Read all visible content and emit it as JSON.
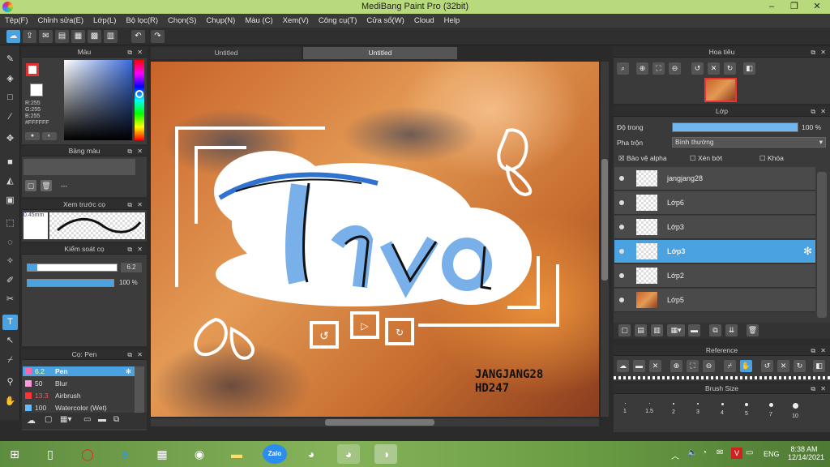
{
  "window": {
    "title": "MediBang Paint Pro (32bit)"
  },
  "menu": [
    "Tệp(F)",
    "Chỉnh sửa(E)",
    "Lớp(L)",
    "Bộ lọc(R)",
    "Chọn(S)",
    "Chụp(N)",
    "Màu (C)",
    "Xem(V)",
    "Công cụ(T)",
    "Cửa sổ(W)",
    "Cloud",
    "Help"
  ],
  "tabs": [
    "Untitled",
    "Untitled"
  ],
  "color_panel": {
    "title": "Màu",
    "r": "R:255",
    "g": "G:255",
    "b": "B:255",
    "hex": "#FFFFFF"
  },
  "palette_panel": {
    "title": "Bảng màu",
    "empty": "---"
  },
  "brush_preview": {
    "title": "Xem trước cọ",
    "size": "0.45mm"
  },
  "brush_control": {
    "title": "Kiểm soát cọ",
    "size_value": "6.2",
    "opacity_value": "100 %"
  },
  "brush_list": {
    "title": "Cọ: Pen",
    "items": [
      {
        "size": "6.2",
        "name": "Pen",
        "color": "#ff66aa"
      },
      {
        "size": "50",
        "name": "Blur",
        "color": "#ff99dd"
      },
      {
        "size": "13.3",
        "name": "Airbrush",
        "color": "#ff3333"
      },
      {
        "size": "100",
        "name": "Watercolor (Wet)",
        "color": "#66bbff"
      }
    ]
  },
  "artwork": {
    "main_text": "Tra",
    "credit_line1": "JANGJANG28",
    "credit_line2": "HD247"
  },
  "navigator": {
    "title": "Hoa tiêu"
  },
  "layer_panel": {
    "title": "Lớp",
    "opacity_label": "Độ trong",
    "opacity_value": "100 %",
    "opacity_fraction": 1.0,
    "blend_label": "Pha trộn",
    "blend_value": "Bình thường",
    "protect_alpha": "Bảo vệ alpha",
    "clipping": "Xén bớt",
    "lock": "Khóa",
    "layers": [
      {
        "name": "jangjang28",
        "active": false
      },
      {
        "name": "Lớp6",
        "active": false
      },
      {
        "name": "Lớp3",
        "active": false
      },
      {
        "name": "Lớp3",
        "active": true
      },
      {
        "name": "Lớp2",
        "active": false
      },
      {
        "name": "Lớp5",
        "active": false
      }
    ]
  },
  "reference": {
    "title": "Reference"
  },
  "brush_size": {
    "title": "Brush Size",
    "sizes": [
      "1",
      "1.5",
      "2",
      "3",
      "4",
      "5",
      "7",
      "10"
    ]
  },
  "taskbar": {
    "lang": "ENG",
    "time": "8:38 AM",
    "date": "12/14/2021",
    "zalo": "Zalo"
  },
  "colors": {
    "accent": "#4aa3e0",
    "titlebar": "#b8d97c"
  }
}
